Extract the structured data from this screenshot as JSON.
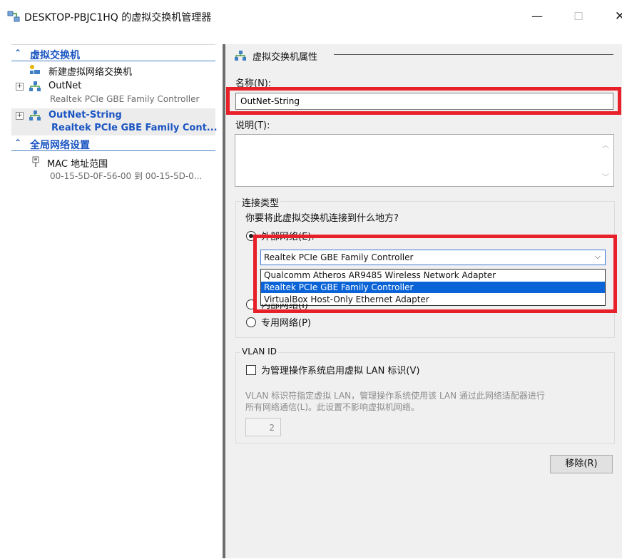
{
  "window": {
    "title": "DESKTOP-PBJC1HQ 的虚拟交换机管理器",
    "minimize": "—",
    "maximize": "☐",
    "close": "✕"
  },
  "left": {
    "switches_header": "虚拟交换机",
    "new_switch_label": "新建虚拟网络交换机",
    "switches": [
      {
        "name": "OutNet",
        "adapter": "Realtek PCIe GBE Family Controller"
      },
      {
        "name": "OutNet-String",
        "adapter": "Realtek PCIe GBE Family Cont..."
      }
    ],
    "global_header": "全局网络设置",
    "mac_label": "MAC 地址范围",
    "mac_range": "00-15-5D-0F-56-00 到 00-15-5D-0..."
  },
  "right": {
    "section_title": "虚拟交换机属性",
    "name_label": "名称(N):",
    "name_value": "OutNet-String",
    "notes_label": "说明(T):",
    "connection_type_title": "连接类型",
    "connection_question": "你要将此虚拟交换机连接到什么地方?",
    "external_label": "外部网络(E):",
    "internal_label": "内部网络(I)",
    "private_label": "专用网络(P)",
    "adapter_selected": "Realtek PCIe GBE Family Controller",
    "adapter_options": [
      "Qualcomm Atheros AR9485 Wireless Network Adapter",
      "Realtek PCIe GBE Family Controller",
      "VirtualBox Host-Only Ethernet Adapter"
    ],
    "vlan_title": "VLAN ID",
    "vlan_checkbox_label": "为管理操作系统启用虚拟 LAN 标识(V)",
    "vlan_desc_line1": "VLAN 标识符指定虚拟 LAN，管理操作系统使用该 LAN 通过此网络适配器进行",
    "vlan_desc_line2": "所有网络通信(L)。此设置不影响虚拟机网络。",
    "vlan_value": "2",
    "remove_button": "移除(R)"
  },
  "colors": {
    "highlight": "#e8202a",
    "link_blue": "#1b55c2",
    "selection_blue": "#0a64d8"
  },
  "icons": [
    "switch-manager-icon",
    "new-switch-icon",
    "network-switch-icon",
    "mac-address-icon"
  ]
}
